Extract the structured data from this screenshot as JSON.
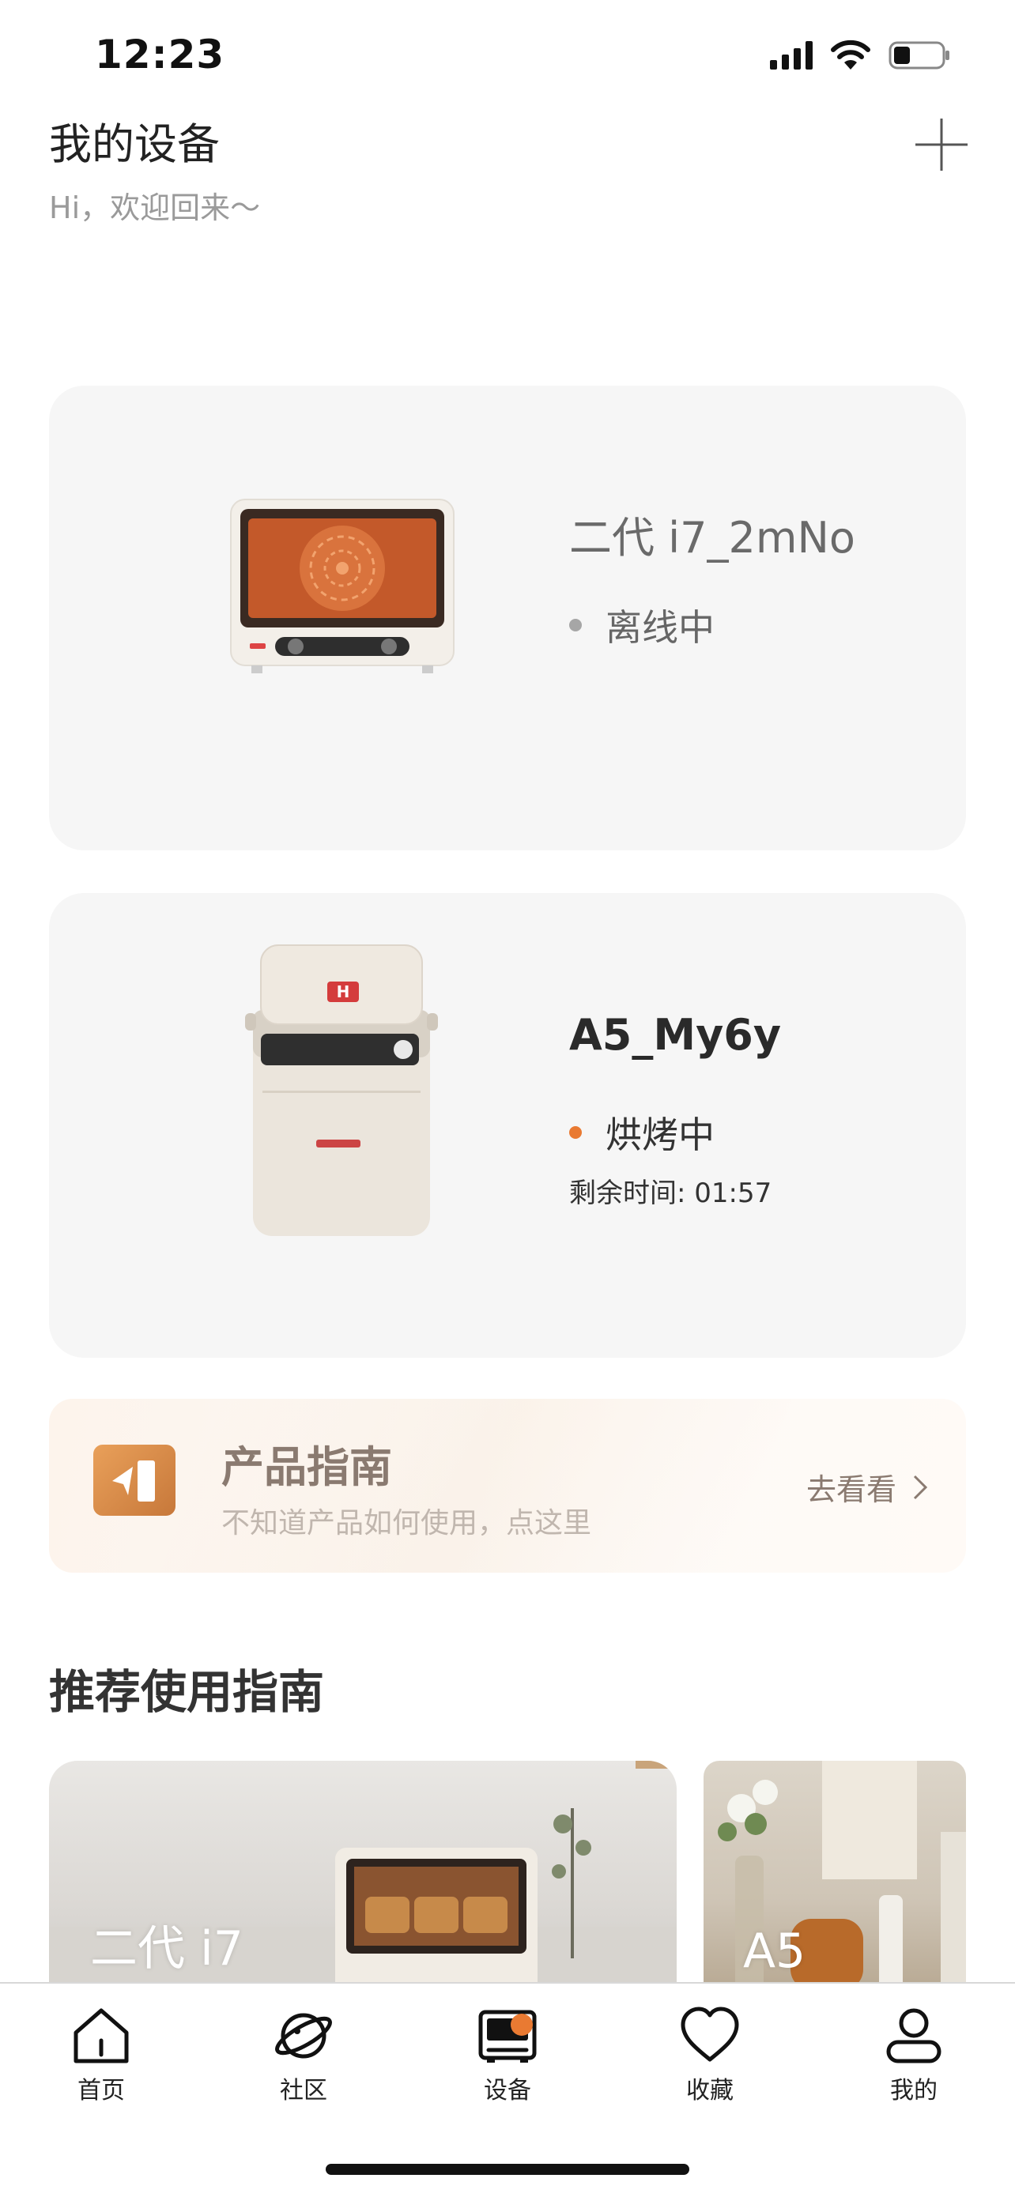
{
  "status_bar": {
    "time": "12:23"
  },
  "header": {
    "title": "我的设备",
    "subtitle": "Hi，欢迎回来～"
  },
  "devices": [
    {
      "name": "二代 i7_2mNo",
      "status": "离线中",
      "status_color": "#a6a6a6",
      "icon": "oven-icon"
    },
    {
      "name": "A5_My6y",
      "status": "烘烤中",
      "status_color": "#e97a32",
      "remaining": "剩余时间: 01:57",
      "icon": "bread-maker-icon"
    }
  ],
  "guide_banner": {
    "title": "产品指南",
    "subtitle": "不知道产品如何使用，点这里",
    "link": "去看看"
  },
  "recommend": {
    "title": "推荐使用指南",
    "cards": [
      {
        "label": "二代 i7"
      },
      {
        "label": "A5"
      }
    ]
  },
  "tabbar": {
    "tabs": [
      {
        "label": "首页",
        "icon": "home-icon"
      },
      {
        "label": "社区",
        "icon": "planet-icon"
      },
      {
        "label": "设备",
        "icon": "device-icon",
        "active": true
      },
      {
        "label": "收藏",
        "icon": "heart-icon"
      },
      {
        "label": "我的",
        "icon": "person-icon"
      }
    ]
  },
  "colors": {
    "accent": "#e97a32",
    "card_bg": "#f6f6f6"
  }
}
